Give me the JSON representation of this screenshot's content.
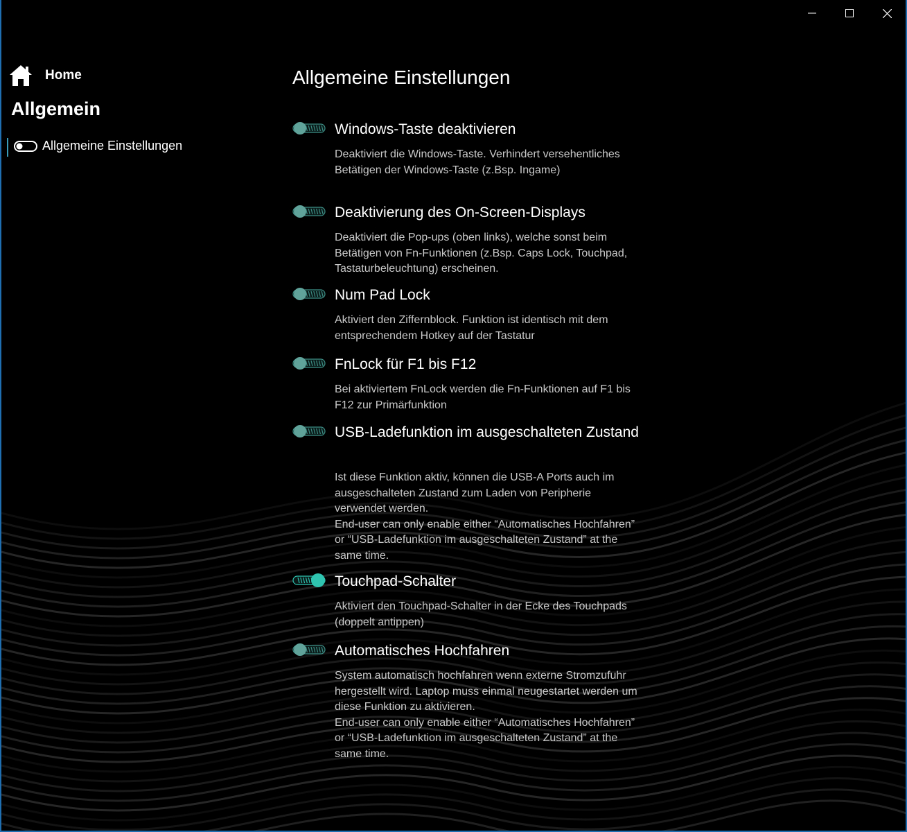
{
  "window": {
    "controls": {
      "minimize": "minimize-icon",
      "maximize": "maximize-icon",
      "close": "close-icon"
    }
  },
  "colors": {
    "accent": "#2ec4b0",
    "accent_dim": "#3e8f86",
    "border": "#1f6fb0",
    "background": "#000000"
  },
  "sidebar": {
    "home_label": "Home",
    "section_title": "Allgemein",
    "items": [
      {
        "label": "Allgemeine Einstellungen",
        "icon": "toggle-icon",
        "selected": true
      }
    ]
  },
  "main": {
    "title": "Allgemeine Einstellungen",
    "settings": [
      {
        "title": "Windows-Taste deaktivieren",
        "description": "Deaktiviert die Windows-Taste. Verhindert versehentliches Betätigen der Windows-Taste (z.Bsp. Ingame)",
        "enabled": false
      },
      {
        "title": "Deaktivierung des On-Screen-Displays",
        "description": "Deaktiviert die Pop-ups (oben links), welche sonst beim Betätigen von Fn-Funktionen (z.Bsp. Caps Lock, Touchpad, Tastaturbeleuchtung) erscheinen.",
        "enabled": false
      },
      {
        "title": "Num Pad Lock",
        "description": "Aktiviert den Ziffernblock. Funktion ist identisch mit dem entsprechendem Hotkey auf der Tastatur",
        "enabled": false
      },
      {
        "title": "FnLock für F1 bis F12",
        "description": "Bei aktiviertem FnLock werden die Fn-Funktionen auf F1 bis F12 zur Primärfunktion",
        "enabled": false
      },
      {
        "title": "USB-Ladefunktion im ausgeschalteten Zustand",
        "description": "Ist diese Funktion aktiv, können die USB-A Ports auch im ausgeschalteten Zustand zum Laden von Peripherie verwendet werden.\nEnd-user can only enable either “Automatisches Hochfahren” or “USB-Ladefunktion im ausgeschalteten Zustand” at the same time.",
        "enabled": false
      },
      {
        "title": "Touchpad-Schalter",
        "description": "Aktiviert den Touchpad-Schalter in der Ecke des Touchpads (doppelt antippen)",
        "enabled": true
      },
      {
        "title": "Automatisches Hochfahren",
        "description": "System automatisch hochfahren wenn externe Stromzufuhr hergestellt wird. Laptop muss einmal neugestartet werden um diese Funktion zu aktivieren.\nEnd-user can only enable either “Automatisches Hochfahren” or “USB-Ladefunktion im ausgeschalteten Zustand” at the same time.",
        "enabled": false
      }
    ]
  }
}
